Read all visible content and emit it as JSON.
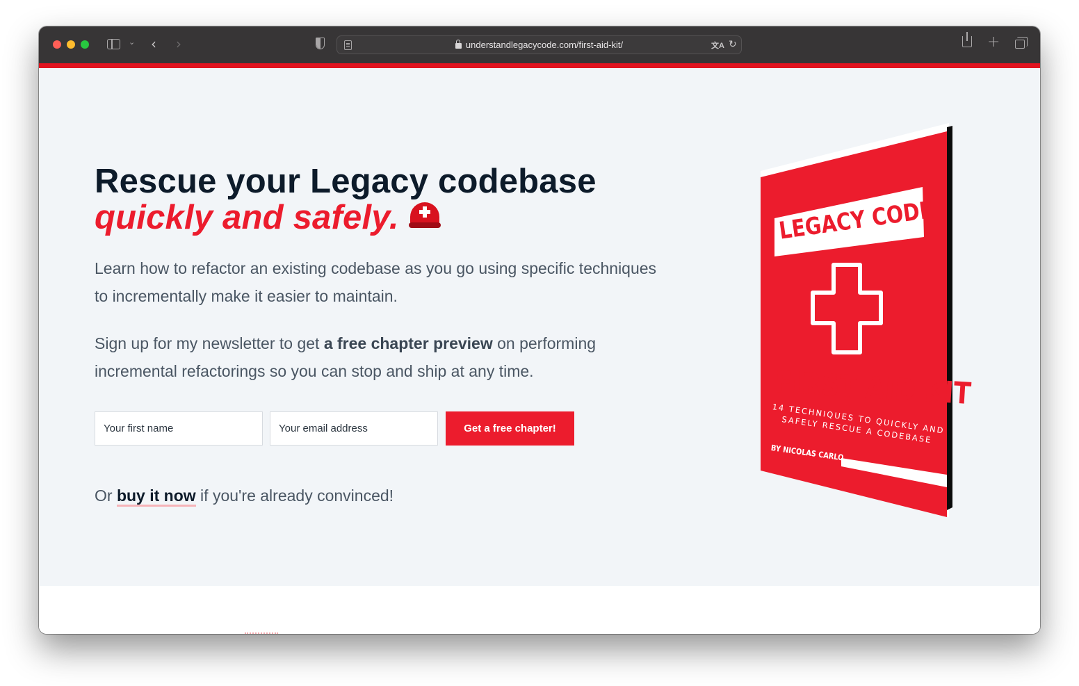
{
  "browser": {
    "url": "understandlegacycode.com/first-aid-kit/",
    "translate_glyph": "文A",
    "reload_glyph": "↻",
    "back_glyph": "‹",
    "forward_glyph": "›",
    "new_tab_glyph": "+",
    "chevron_glyph": "⌄"
  },
  "hero": {
    "headline_line1": "Rescue your Legacy codebase",
    "headline_line2": "quickly and safely.",
    "lead1": "Learn how to refactor an existing codebase as you go using specific techniques to incrementally make it easier to maintain.",
    "lead2_before": "Sign up for my newsletter to get ",
    "lead2_bold": "a free chapter preview",
    "lead2_after": " on performing incremental refactorings so you can stop and ship at any time.",
    "name_placeholder": "Your first name",
    "email_placeholder": "Your email address",
    "cta_label": "Get a free chapter!",
    "or_before": "Or ",
    "buy_link": "buy it now",
    "or_after": " if you're already convinced!"
  },
  "book": {
    "title": "LEGACY CODE",
    "name": "FIRST AID KIT",
    "subtitle_line1": "14 TECHNIQUES TO QUICKLY AND",
    "subtitle_line2": "SAFELY RESCUE A CODEBASE",
    "author": "BY NICOLAS CARLO"
  },
  "colors": {
    "brand_red": "#ec1c2d",
    "heading": "#0d1b2a",
    "hero_bg": "#f2f5f8"
  },
  "icons": [
    "sidebar-icon",
    "shield-icon",
    "reader-icon",
    "lock-icon",
    "translate-icon",
    "reload-icon",
    "share-icon",
    "tabs-icon",
    "rescue-helmet-icon",
    "first-aid-cross-icon"
  ]
}
